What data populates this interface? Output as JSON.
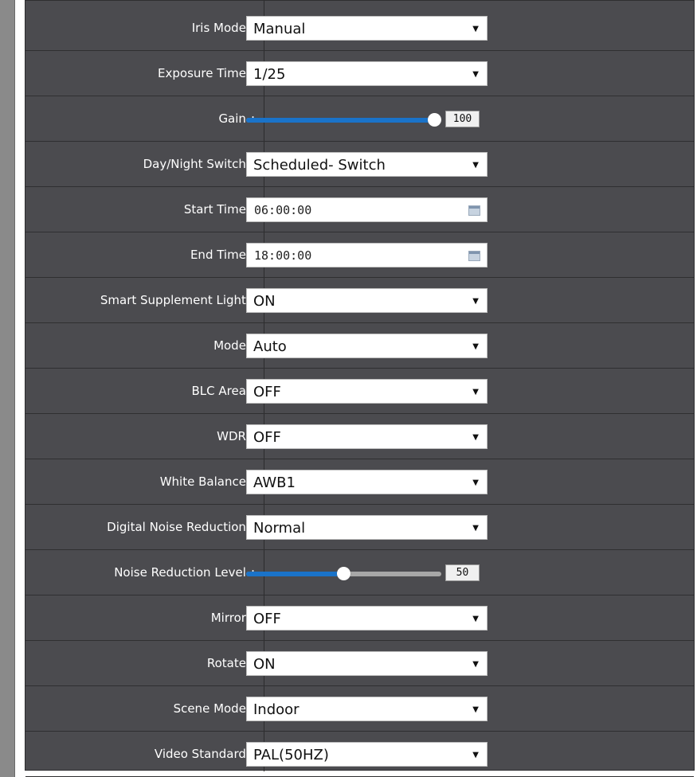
{
  "settings": [
    {
      "label": "Iris Mode",
      "type": "select",
      "value": "Manual"
    },
    {
      "label": "Exposure Time",
      "type": "select",
      "value": "1/25"
    },
    {
      "label": "Gain",
      "type": "slider",
      "value": "100",
      "level": 1.0
    },
    {
      "label": "Day/Night Switch",
      "type": "select",
      "value": "Scheduled- Switch"
    },
    {
      "label": "Start Time",
      "type": "time",
      "value": "06:00:00"
    },
    {
      "label": "End Time",
      "type": "time",
      "value": "18:00:00"
    },
    {
      "label": "Smart Supplement Light",
      "type": "select",
      "value": "ON"
    },
    {
      "label": "Mode",
      "type": "select",
      "value": "Auto"
    },
    {
      "label": "BLC Area",
      "type": "select",
      "value": "OFF"
    },
    {
      "label": "WDR",
      "type": "select",
      "value": "OFF"
    },
    {
      "label": "White Balance",
      "type": "select",
      "value": "AWB1"
    },
    {
      "label": "Digital Noise Reduction",
      "type": "select",
      "value": "Normal"
    },
    {
      "label": "Noise Reduction Level",
      "type": "slider",
      "value": "50",
      "level": 0.5
    },
    {
      "label": "Mirror",
      "type": "select",
      "value": "OFF"
    },
    {
      "label": "Rotate",
      "type": "select",
      "value": "ON"
    },
    {
      "label": "Scene Mode",
      "type": "select",
      "value": "Indoor"
    },
    {
      "label": "Video Standard",
      "type": "select",
      "value": "PAL(50HZ)"
    }
  ],
  "colon": ":",
  "dropdown_arrow": "▼",
  "colors": {
    "panel": "#4b4b4f",
    "slider_fill": "#1a73c9",
    "slider_track": "#a7a7a7"
  },
  "icons": {
    "time_picker": "calendar-icon"
  }
}
